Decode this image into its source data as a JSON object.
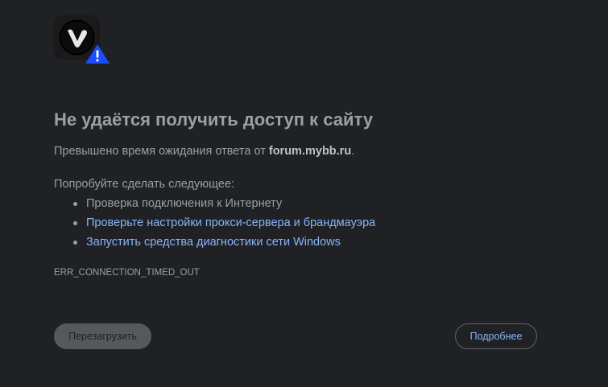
{
  "error_page": {
    "title": "Не удаётся получить доступ к сайту",
    "subtitle_prefix": "Превышено время ожидания ответа от ",
    "host": "forum.mybb.ru",
    "subtitle_suffix": ".",
    "try_label": "Попробуйте сделать следующее:",
    "suggestions": [
      {
        "label": "Проверка подключения к Интернету",
        "is_link": false
      },
      {
        "label": "Проверьте настройки прокси-сервера и брандмауэра",
        "is_link": true
      },
      {
        "label": "Запустить средства диагностики сети Windows",
        "is_link": true
      }
    ],
    "error_code": "ERR_CONNECTION_TIMED_OUT",
    "reload_button": "Перезагрузить",
    "details_button": "Подробнее"
  },
  "icons": {
    "app_logo": "vivaldi-logo-icon",
    "warning_badge": "warning-triangle-icon"
  },
  "colors": {
    "background": "#202124",
    "text": "#9aa0a6",
    "link": "#8ab4f8",
    "warning": "#1a4dff"
  }
}
